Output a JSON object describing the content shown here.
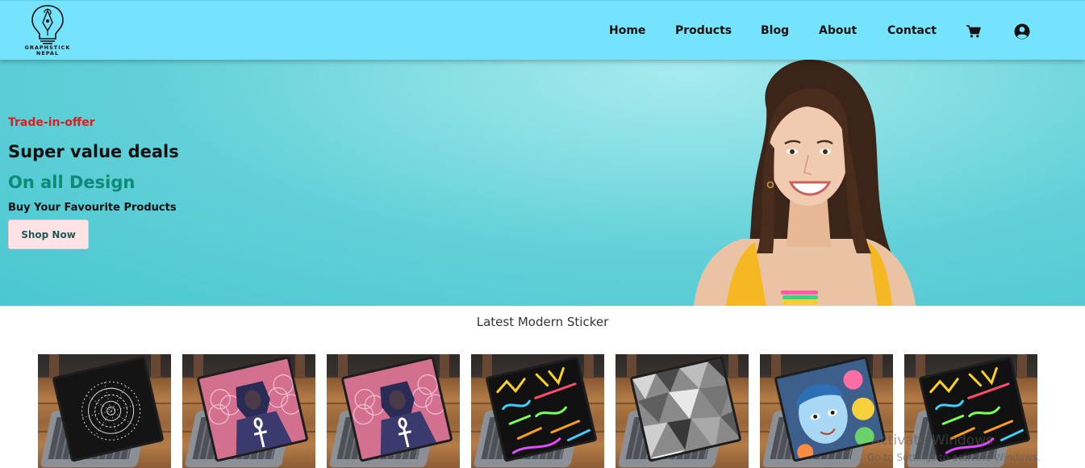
{
  "header": {
    "logo_text": [
      "GRAPHSTICK",
      "NEPAL"
    ],
    "nav": [
      {
        "label": "Home"
      },
      {
        "label": "Products"
      },
      {
        "label": "Blog"
      },
      {
        "label": "About"
      },
      {
        "label": "Contact"
      }
    ],
    "icons": [
      "cart-icon",
      "user-account-icon"
    ],
    "background": "#74e3fb"
  },
  "hero": {
    "kicker": "Trade-in-offer",
    "headline": "Super value deals",
    "subheadline": "On all Design",
    "tagline": "Buy Your Favourite Products",
    "cta_label": "Shop Now",
    "colors": {
      "kicker": "#e31b1b",
      "subheadline": "#0d8a77",
      "cta_bg": "#fde3e5"
    }
  },
  "products": {
    "title": "Latest Modern Sticker",
    "items": [
      {
        "design": "black mandala"
      },
      {
        "design": "pharaoh flower of life"
      },
      {
        "design": "pharaoh flower of life"
      },
      {
        "design": "graffiti text"
      },
      {
        "design": "grey geometric"
      },
      {
        "design": "cartoon face"
      },
      {
        "design": "graffiti text"
      }
    ]
  },
  "watermark": {
    "title": "Activate Windows",
    "subtitle": "Go to Settings to activate Windows."
  }
}
